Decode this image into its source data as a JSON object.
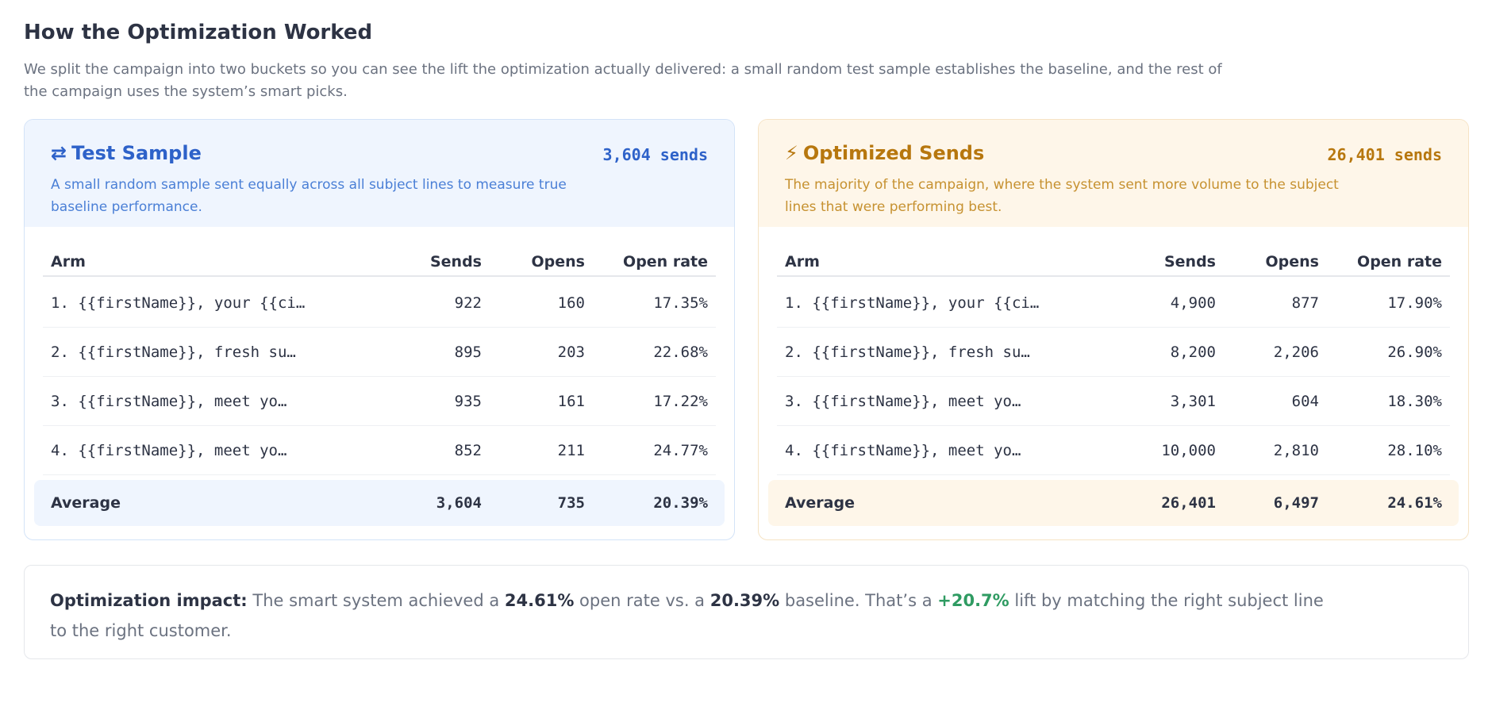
{
  "page": {
    "title": "How the Optimization Worked",
    "intro": "We split the campaign into two buckets so you can see the lift the optimization actually delivered: a small random test sample establishes the baseline, and the rest of the campaign uses the system’s smart picks."
  },
  "columns": {
    "arm": "Arm",
    "sends": "Sends",
    "opens": "Opens",
    "rate": "Open rate"
  },
  "test": {
    "icon": "⇄",
    "icon_name": "swap-arrows-icon",
    "title": "Test Sample",
    "sends_count": "3,604 sends",
    "description": "A small random sample sent equally across all subject lines to measure true baseline performance.",
    "accent": "#2e62c9",
    "rows": [
      {
        "arm": "1. {{firstName}}, your {{ci…",
        "sends": "922",
        "opens": "160",
        "rate": "17.35%"
      },
      {
        "arm": "2. {{firstName}}, fresh su…",
        "sends": "895",
        "opens": "203",
        "rate": "22.68%"
      },
      {
        "arm": "3. {{firstName}}, meet yo…",
        "sends": "935",
        "opens": "161",
        "rate": "17.22%"
      },
      {
        "arm": "4. {{firstName}}, meet yo…",
        "sends": "852",
        "opens": "211",
        "rate": "24.77%"
      }
    ],
    "average": {
      "label": "Average",
      "sends": "3,604",
      "opens": "735",
      "rate": "20.39%"
    }
  },
  "optimized": {
    "icon": "⚡",
    "icon_name": "lightning-icon",
    "title": "Optimized Sends",
    "sends_count": "26,401 sends",
    "description": "The majority of the campaign, where the system sent more volume to the subject lines that were performing best.",
    "accent": "#b7770e",
    "rows": [
      {
        "arm": "1. {{firstName}}, your {{ci…",
        "sends": "4,900",
        "opens": "877",
        "rate": "17.90%"
      },
      {
        "arm": "2. {{firstName}}, fresh su…",
        "sends": "8,200",
        "opens": "2,206",
        "rate": "26.90%"
      },
      {
        "arm": "3. {{firstName}}, meet yo…",
        "sends": "3,301",
        "opens": "604",
        "rate": "18.30%"
      },
      {
        "arm": "4. {{firstName}}, meet yo…",
        "sends": "10,000",
        "opens": "2,810",
        "rate": "28.10%"
      }
    ],
    "average": {
      "label": "Average",
      "sends": "26,401",
      "opens": "6,497",
      "rate": "24.61%"
    }
  },
  "impact": {
    "label": "Optimization impact:",
    "part1": " The smart system achieved a ",
    "optimized_rate": "24.61%",
    "part2": " open rate vs. a ",
    "baseline_rate": "20.39%",
    "part3": " baseline. That’s a ",
    "lift": "+20.7%",
    "part4": " lift by matching the right subject line to the right customer.",
    "lift_color": "#2f9b62"
  }
}
